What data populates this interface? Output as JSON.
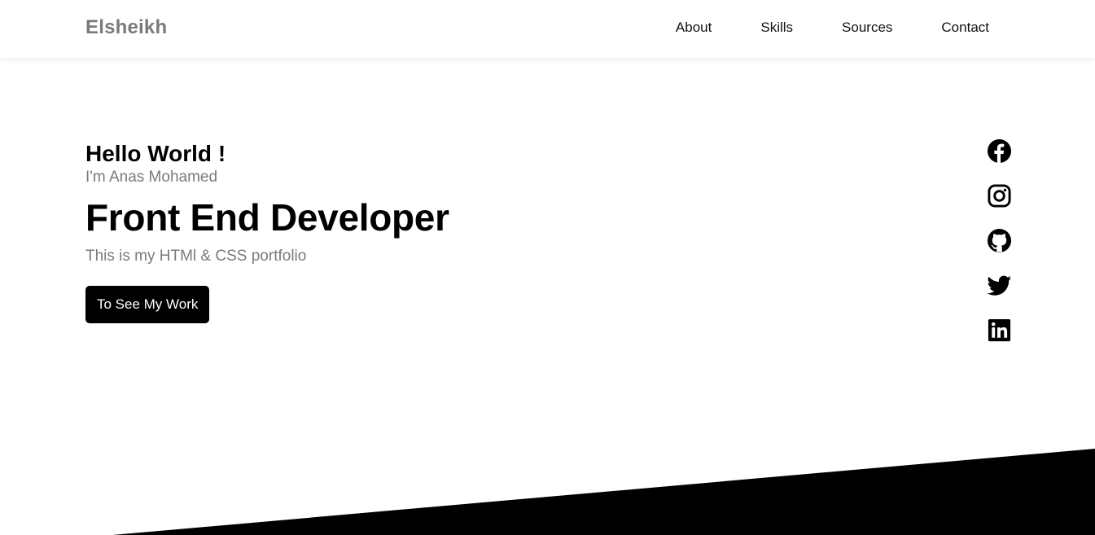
{
  "header": {
    "logo": "Elsheikh",
    "nav": [
      {
        "label": "About"
      },
      {
        "label": "Skills"
      },
      {
        "label": "Sources"
      },
      {
        "label": "Contact"
      }
    ]
  },
  "hero": {
    "greeting": "Hello World !",
    "intro": "I'm Anas Mohamed",
    "role": "Front End Developer",
    "tagline": "This is my HTMl & CSS portfolio",
    "cta_label": "To See My Work"
  },
  "social": {
    "icons": [
      "facebook-icon",
      "instagram-icon",
      "github-icon",
      "twitter-icon",
      "linkedin-icon"
    ]
  },
  "colors": {
    "accent": "#000000",
    "muted_text": "#7a7a7a",
    "background": "#ffffff"
  }
}
